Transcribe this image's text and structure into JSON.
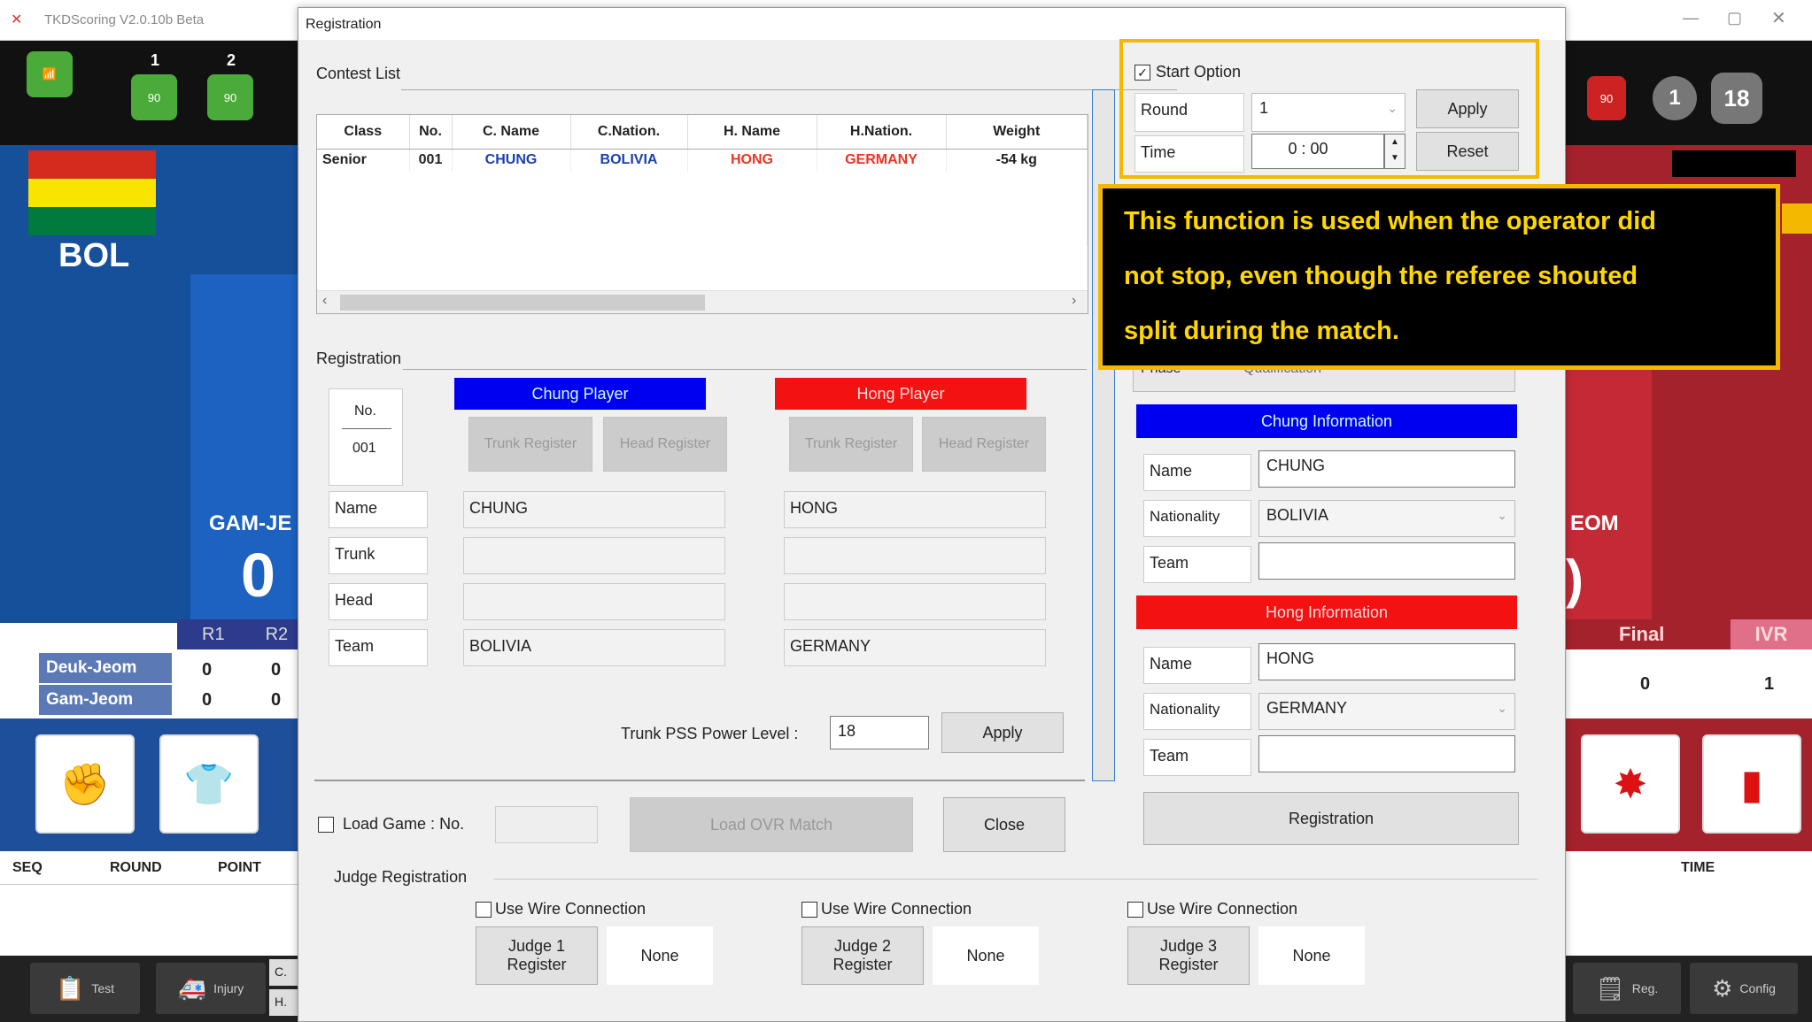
{
  "app": {
    "window_title": "TKDScoring V2.0.10b Beta",
    "blue": {
      "country": "BOL",
      "gam_jeom_label": "GAM-JE",
      "score": "0"
    },
    "red": {
      "gam_jeom_label": "EOM",
      "score_partial": ")"
    },
    "top_numbers": [
      "1",
      "2",
      "1",
      "18"
    ],
    "round_headers": [
      "R1",
      "R2"
    ],
    "row_labels": [
      "Deuk-Jeom",
      "Gam-Jeom"
    ],
    "row_values": [
      [
        "0",
        "0"
      ],
      [
        "0",
        "0"
      ]
    ],
    "right_headers": [
      "Final",
      "IVR"
    ],
    "right_values": [
      "0",
      "1"
    ],
    "log_headers": [
      "SEQ",
      "ROUND",
      "POINT"
    ],
    "log_right_header": "TIME",
    "bottom_buttons": {
      "test": "Test",
      "injury": "Injury",
      "reg": "Reg.",
      "config": "Config",
      "c": "C.",
      "h": "H."
    }
  },
  "dialog": {
    "title": "Registration",
    "contest_list_label": "Contest List",
    "table": {
      "headers": [
        "Class",
        "No.",
        "C. Name",
        "C.Nation.",
        "H. Name",
        "H.Nation.",
        "Weight"
      ],
      "rows": [
        [
          "Senior",
          "001",
          "CHUNG",
          "BOLIVIA",
          "HONG",
          "GERMANY",
          "-54 kg"
        ]
      ]
    },
    "registration_label": "Registration",
    "no_label": "No.",
    "no_value": "001",
    "chung_player": "Chung Player",
    "hong_player": "Hong Player",
    "trunk_register": "Trunk Register",
    "head_register": "Head Register",
    "field_labels": [
      "Name",
      "Trunk",
      "Head",
      "Team"
    ],
    "chung_values": {
      "name": "CHUNG",
      "team": "BOLIVIA"
    },
    "hong_values": {
      "name": "HONG",
      "team": "GERMANY"
    },
    "trunk_pss_label": "Trunk PSS Power Level :",
    "trunk_pss_value": "18",
    "apply": "Apply",
    "load_game_label": "Load Game : No.",
    "load_ovr_match": "Load OVR Match",
    "close": "Close",
    "judge_registration": "Judge Registration",
    "judges": [
      {
        "wire": "Use Wire Connection",
        "register": "Judge 1 Register",
        "status": "None"
      },
      {
        "wire": "Use Wire Connection",
        "register": "Judge 2 Register",
        "status": "None"
      },
      {
        "wire": "Use Wire Connection",
        "register": "Judge 3 Register",
        "status": "None"
      }
    ],
    "start_option": {
      "label": "Start Option",
      "checked": true,
      "round_label": "Round",
      "round_value": "1",
      "time_label": "Time",
      "time_value": "0 : 00",
      "apply": "Apply",
      "reset": "Reset"
    },
    "phase_label": "Phase",
    "phase_value": "Qualification",
    "chung_info": {
      "header": "Chung Information",
      "name_label": "Name",
      "name": "CHUNG",
      "nationality_label": "Nationality",
      "nationality": "BOLIVIA",
      "team_label": "Team",
      "team": ""
    },
    "hong_info": {
      "header": "Hong Information",
      "name_label": "Name",
      "name": "HONG",
      "nationality_label": "Nationality",
      "nationality": "GERMANY",
      "team_label": "Team",
      "team": ""
    },
    "registration_button": "Registration"
  },
  "callout": {
    "line1": "This function is used when the operator did",
    "line2": "not stop, even though the referee shouted",
    "line3": "split during the match."
  },
  "colors": {
    "callout_border": "#f5b800",
    "callout_text": "#ffd700",
    "chung_blue": "#0000f0",
    "hong_red": "#f31111"
  }
}
